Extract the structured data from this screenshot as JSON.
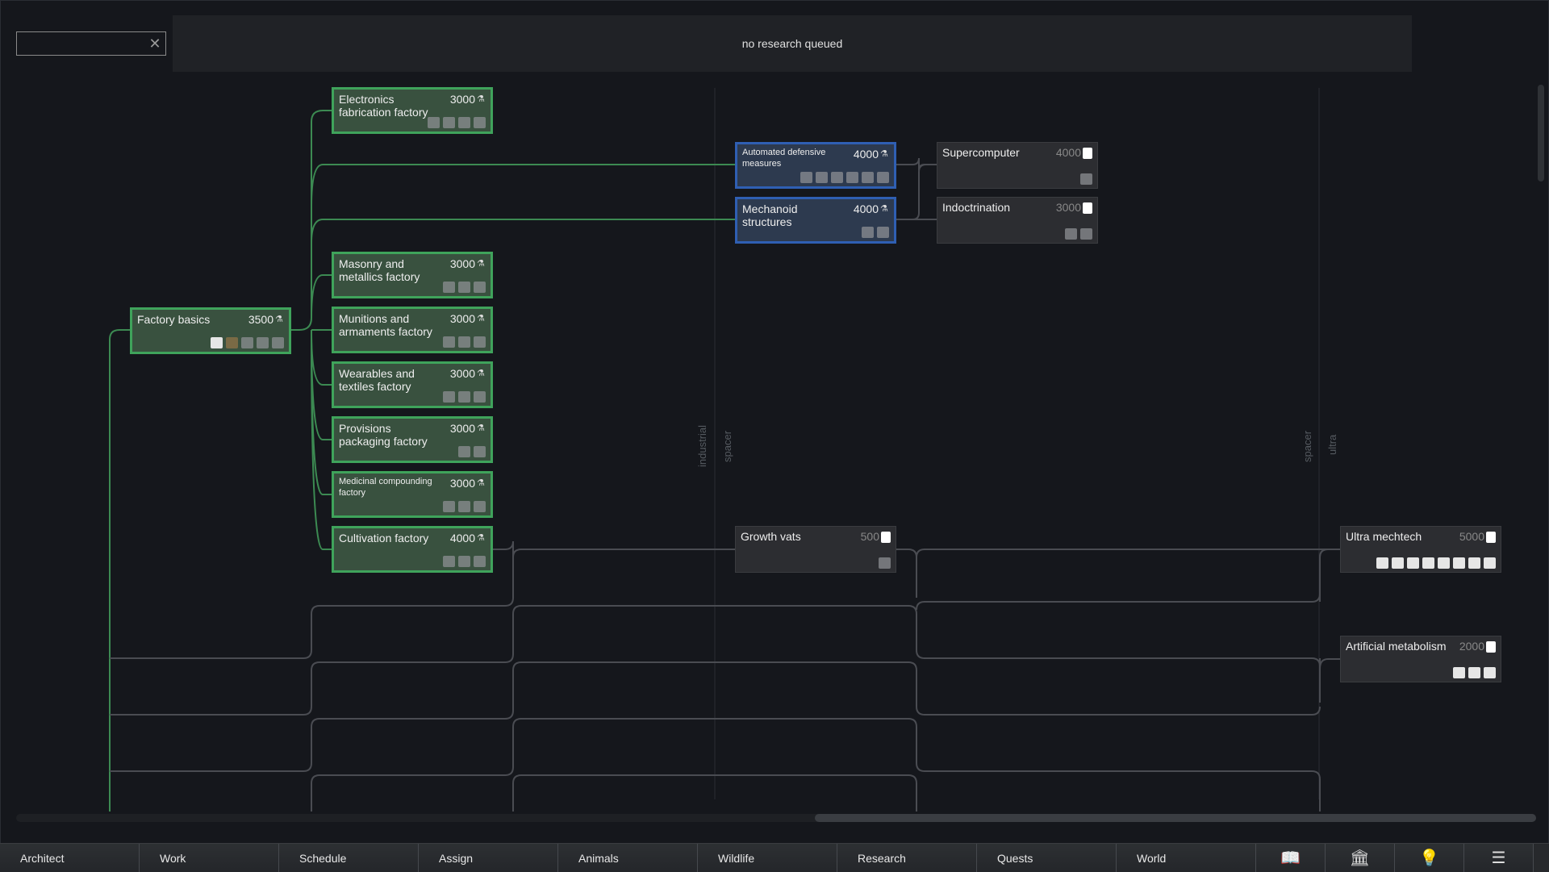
{
  "search": {
    "value": "",
    "placeholder": ""
  },
  "queue": {
    "status": "no research queued"
  },
  "tech_levels": {
    "industrial": "industrial",
    "spacer": "spacer",
    "spacer2": "spacer",
    "ultra": "ultra"
  },
  "nodes": [
    {
      "title": "Factory basics",
      "cost": "3500",
      "state": "done"
    },
    {
      "title": "Electronics fabrication factory",
      "cost": "3000",
      "state": "done"
    },
    {
      "title": "Masonry and metallics factory",
      "cost": "3000",
      "state": "done"
    },
    {
      "title": "Munitions and armaments factory",
      "cost": "3000",
      "state": "done"
    },
    {
      "title": "Wearables and textiles factory",
      "cost": "3000",
      "state": "done"
    },
    {
      "title": "Provisions packaging factory",
      "cost": "3000",
      "state": "done"
    },
    {
      "title": "Medicinal compounding factory",
      "cost": "3000",
      "state": "done"
    },
    {
      "title": "Cultivation factory",
      "cost": "4000",
      "state": "done"
    },
    {
      "title": "Automated defensive measures",
      "cost": "4000",
      "state": "selected"
    },
    {
      "title": "Mechanoid structures",
      "cost": "4000",
      "state": "selected"
    },
    {
      "title": "Supercomputer",
      "cost": "4000",
      "state": "locked"
    },
    {
      "title": "Indoctrination",
      "cost": "3000",
      "state": "locked"
    },
    {
      "title": "Growth vats",
      "cost": "500",
      "state": "locked"
    },
    {
      "title": "Ultra mechtech",
      "cost": "5000",
      "state": "locked"
    },
    {
      "title": "Artificial metabolism",
      "cost": "2000",
      "state": "locked"
    }
  ],
  "tabs": [
    "Architect",
    "Work",
    "Schedule",
    "Assign",
    "Animals",
    "Wildlife",
    "Research",
    "Quests",
    "World"
  ],
  "icon_buttons": [
    "book-icon",
    "museum-icon",
    "lightbulb-icon",
    "menu-list-icon"
  ]
}
